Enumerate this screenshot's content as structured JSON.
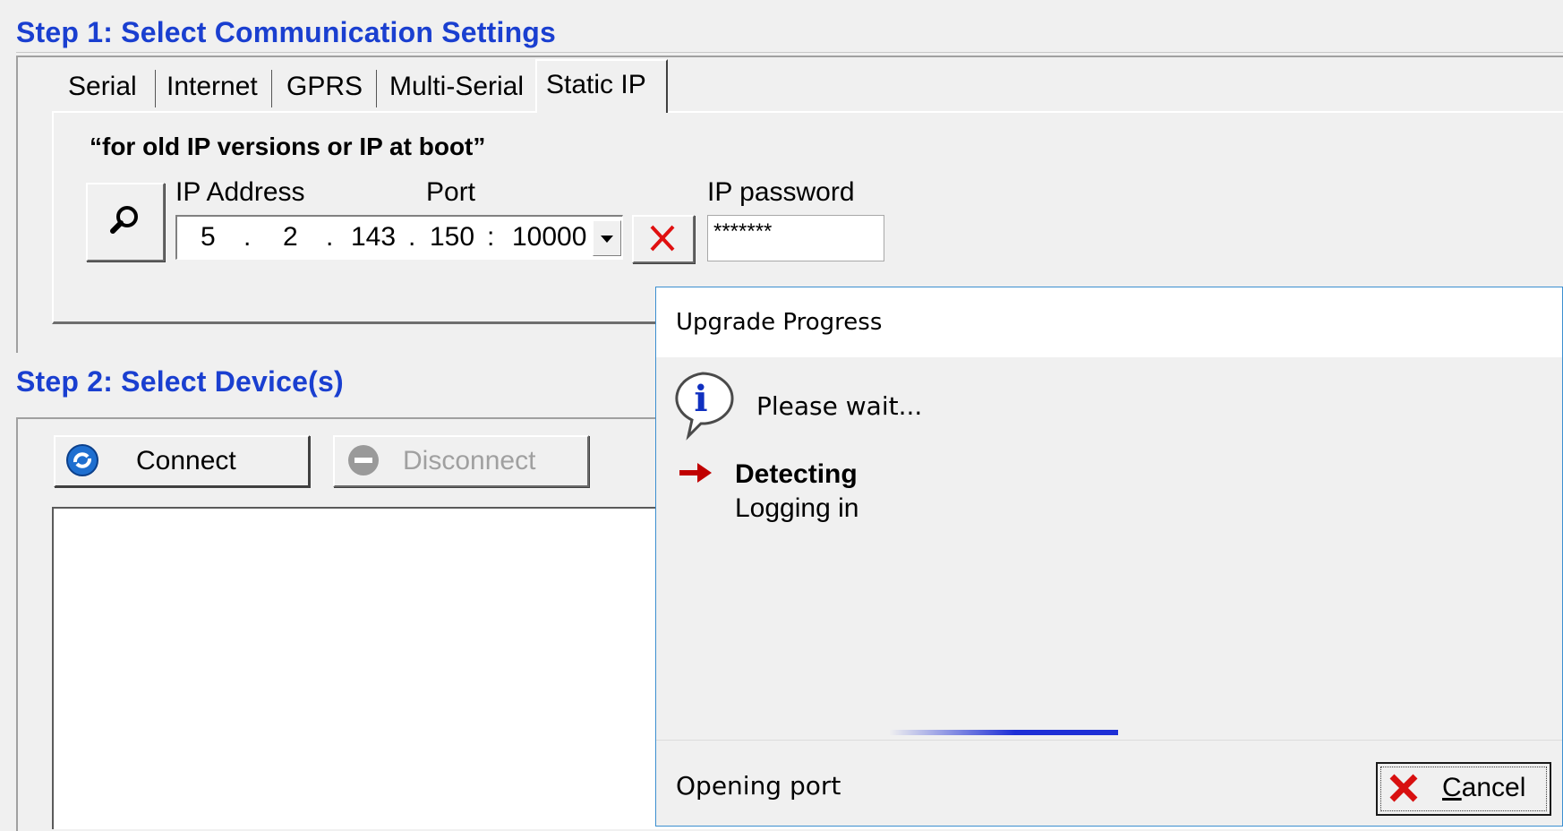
{
  "step1": {
    "title": "Step 1: Select Communication Settings",
    "tabs": [
      "Serial",
      "Internet",
      "GPRS",
      "Multi-Serial",
      "Static IP"
    ],
    "active_tab": "Static IP",
    "note": "“for old IP versions or IP at boot”",
    "ip_label": "IP Address",
    "port_label": "Port",
    "password_label": "IP password",
    "ip": {
      "o1": "5",
      "o2": "2",
      "o3": "143",
      "o4": "150",
      "sep": ".",
      "colon": ":",
      "port": "10000"
    },
    "password_mask": "*******",
    "icons": {
      "search": "magnifier-icon",
      "clear": "red-x-icon",
      "dropdown": "triangle-down-icon"
    }
  },
  "step2": {
    "title": "Step 2: Select Device(s)",
    "connect_label": "Connect",
    "disconnect_label": "Disconnect"
  },
  "dialog": {
    "title": "Upgrade Progress",
    "message": "Please wait...",
    "current_step": "Detecting",
    "next_step": "Logging in",
    "status": "Opening port",
    "cancel_prefix": "",
    "cancel_underlined": "C",
    "cancel_rest": "ancel",
    "colors": {
      "accent_border": "#3c8fd0",
      "arrow": "#c00000",
      "progress": "#1e2fd6"
    }
  },
  "colors": {
    "step_title": "#1a3fd0",
    "background": "#f0f0f0"
  }
}
